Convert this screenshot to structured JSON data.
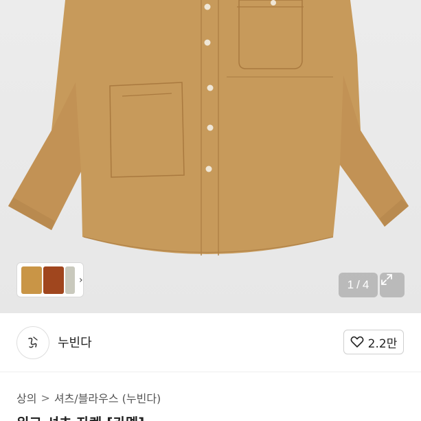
{
  "gallery": {
    "page_current": "1",
    "page_separator": "/",
    "page_total": "4",
    "thumbnail_colors": [
      "#c99546",
      "#a0461e",
      "#c9c9bd"
    ],
    "shirt_color": "#c79a5b"
  },
  "seller": {
    "name": "누빈다",
    "likes": "2.2만"
  },
  "breadcrumb": {
    "category": "상의",
    "separator": ">",
    "subcategory": "셔츠/블라우스 (누빈다)"
  },
  "product": {
    "title": "워크 셔츠 자켓 [카멜]"
  }
}
